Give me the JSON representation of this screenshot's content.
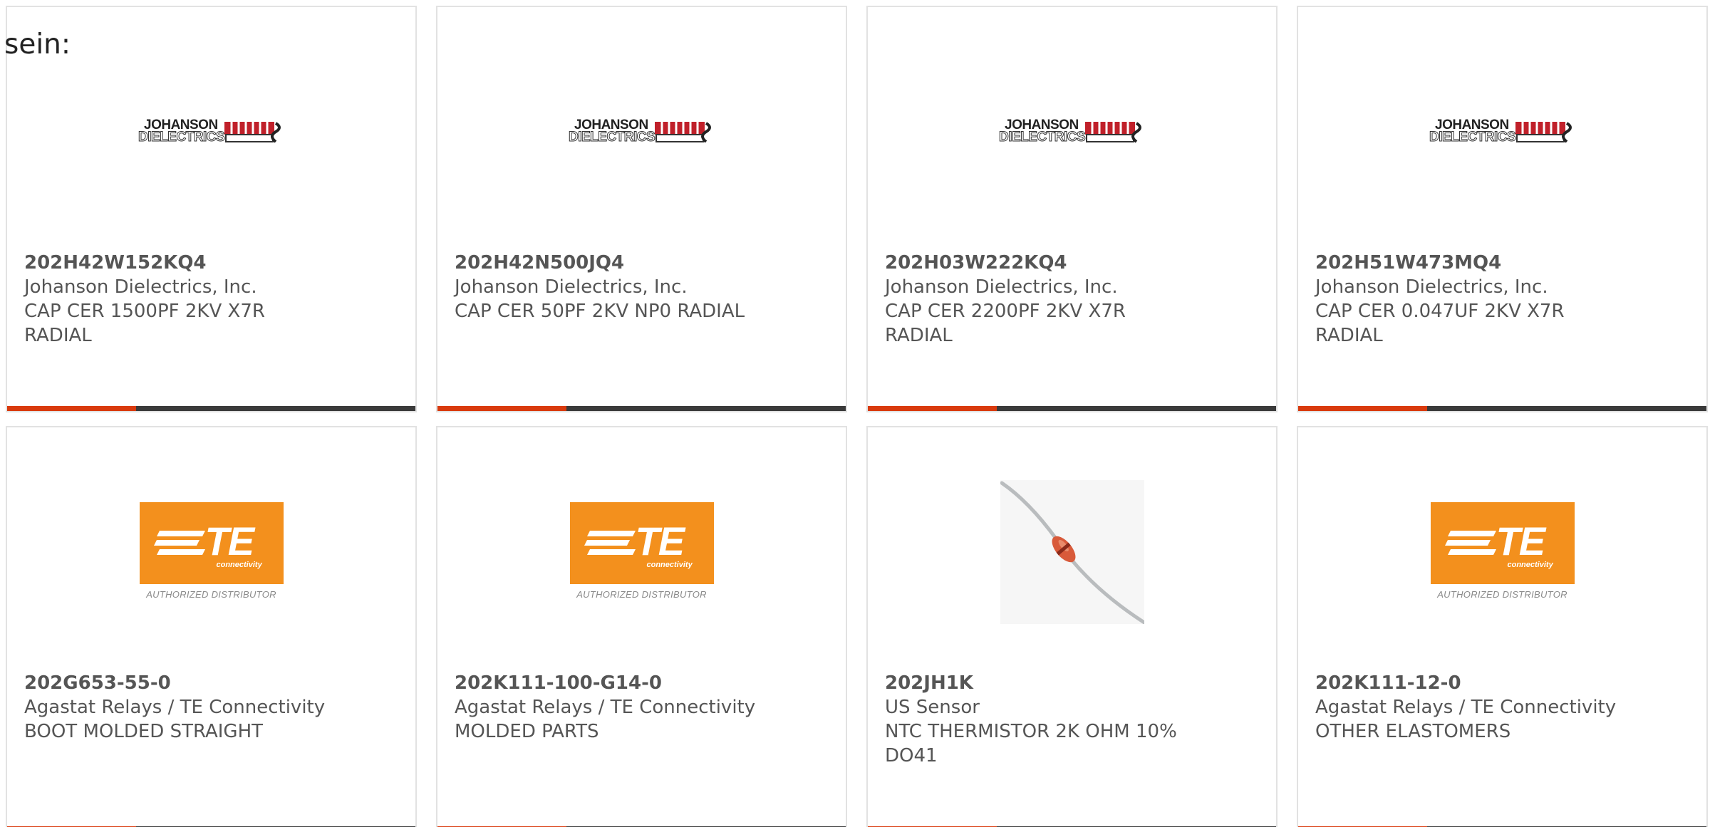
{
  "intro": {
    "text": "sein:"
  },
  "brand": {
    "accent": "#d93a0e",
    "bar": "#3a3a3a",
    "te_orange": "#f3901d"
  },
  "products": [
    {
      "part_number": "202H42W152KQ4",
      "manufacturer": "Johanson Dielectrics, Inc.",
      "description": "CAP CER 1500PF 2KV X7R RADIAL",
      "image": "johanson-logo",
      "logo_text": {
        "top": "JOHANSON",
        "bottom": "DIELECTRICS"
      }
    },
    {
      "part_number": "202H42N500JQ4",
      "manufacturer": "Johanson Dielectrics, Inc.",
      "description": "CAP CER 50PF 2KV NP0 RADIAL",
      "image": "johanson-logo",
      "logo_text": {
        "top": "JOHANSON",
        "bottom": "DIELECTRICS"
      }
    },
    {
      "part_number": "202H03W222KQ4",
      "manufacturer": "Johanson Dielectrics, Inc.",
      "description": "CAP CER 2200PF 2KV X7R RADIAL",
      "image": "johanson-logo",
      "logo_text": {
        "top": "JOHANSON",
        "bottom": "DIELECTRICS"
      }
    },
    {
      "part_number": "202H51W473MQ4",
      "manufacturer": "Johanson Dielectrics, Inc.",
      "description": "CAP CER 0.047UF 2KV X7R RADIAL",
      "image": "johanson-logo",
      "logo_text": {
        "top": "JOHANSON",
        "bottom": "DIELECTRICS"
      }
    },
    {
      "part_number": "202G653-55-0",
      "manufacturer": "Agastat Relays / TE Connectivity",
      "description": "BOOT MOLDED STRAIGHT",
      "image": "te-logo",
      "logo_text": {
        "main": "TE",
        "sub": "connectivity",
        "caption": "AUTHORIZED DISTRIBUTOR"
      }
    },
    {
      "part_number": "202K111-100-G14-0",
      "manufacturer": "Agastat Relays / TE Connectivity",
      "description": "MOLDED PARTS",
      "image": "te-logo",
      "logo_text": {
        "main": "TE",
        "sub": "connectivity",
        "caption": "AUTHORIZED DISTRIBUTOR"
      }
    },
    {
      "part_number": "202JH1K",
      "manufacturer": "US Sensor",
      "description": "NTC THERMISTOR 2K OHM 10% DO41",
      "image": "thermistor-photo"
    },
    {
      "part_number": "202K111-12-0",
      "manufacturer": "Agastat Relays / TE Connectivity",
      "description": "OTHER ELASTOMERS",
      "image": "te-logo",
      "logo_text": {
        "main": "TE",
        "sub": "connectivity",
        "caption": "AUTHORIZED DISTRIBUTOR"
      }
    }
  ]
}
